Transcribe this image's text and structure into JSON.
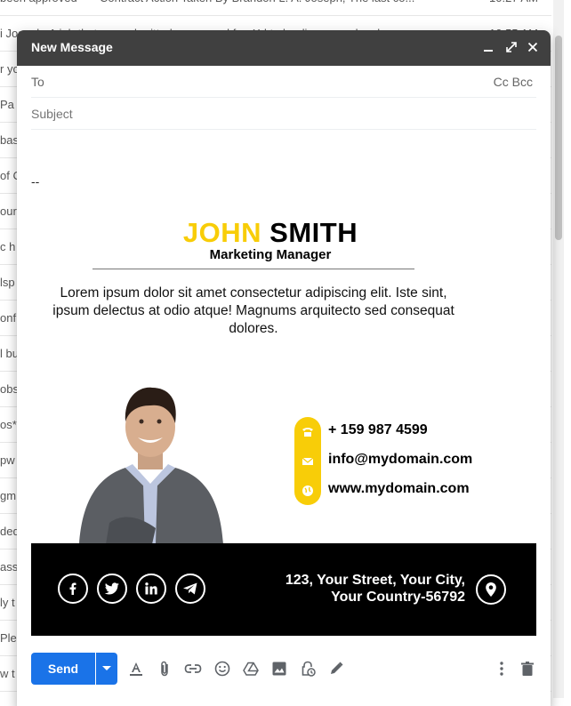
{
  "inbox_rows": [
    {
      "left": "been approved",
      "right": "Contract Action Taken By Brandon L. A. Joseph, The last co...",
      "time": "10:27 AM"
    },
    {
      "left": "i Joseph, A job that you submitted a proposal for: Xd to landing page, has bee",
      "right": "",
      "time": "10:55 AM"
    },
    {
      "left": "r yo",
      "right": "",
      "time": ""
    },
    {
      "left": "Pa",
      "right": "",
      "time": ""
    },
    {
      "left": "bas",
      "right": "",
      "time": ""
    },
    {
      "left": "of C",
      "right": "",
      "time": ""
    },
    {
      "left": "our",
      "right": "",
      "time": ""
    },
    {
      "left": "c h",
      "right": "",
      "time": ""
    },
    {
      "left": "lsp",
      "right": "",
      "time": ""
    },
    {
      "left": "onfi",
      "right": "",
      "time": ""
    },
    {
      "left": "l bu",
      "right": "",
      "time": ""
    },
    {
      "left": "obs",
      "right": "",
      "time": ""
    },
    {
      "left": "os**",
      "right": "",
      "time": ""
    },
    {
      "left": "pw",
      "right": "",
      "time": ""
    },
    {
      "left": "gm",
      "right": "",
      "time": ""
    },
    {
      "left": "ded",
      "right": "",
      "time": ""
    },
    {
      "left": "ass",
      "right": "",
      "time": ""
    },
    {
      "left": "ly t",
      "right": "",
      "time": ""
    },
    {
      "left": "Ple",
      "right": "",
      "time": ""
    },
    {
      "left": "w t",
      "right": "",
      "time": ""
    }
  ],
  "compose": {
    "title": "New Message",
    "to_label": "To",
    "cc_bcc": "Cc Bcc",
    "subject_placeholder": "Subject",
    "sig_dashes": "--"
  },
  "signature": {
    "first_name": "JOHN",
    "last_name": "SMITH",
    "role": "Marketing Manager",
    "description": "Lorem ipsum dolor sit amet consectetur adipiscing elit. Iste sint, ipsum delectus at odio atque! Magnums arquitecto sed consequat dolores.",
    "phone": "+ 159 987 4599",
    "email": "info@mydomain.com",
    "website": "www.mydomain.com",
    "address_line1": "123, Your Street, Your City,",
    "address_line2": "Your Country-56792",
    "accent_color": "#f8cd08"
  },
  "toolbar": {
    "send_label": "Send"
  }
}
